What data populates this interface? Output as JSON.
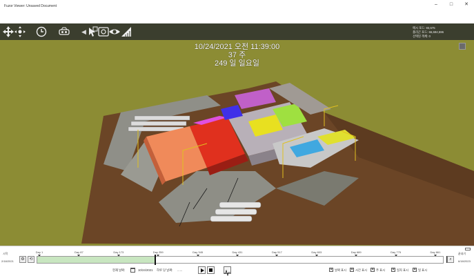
{
  "window": {
    "title": "Fuzor Viewer: Unsaved Document",
    "minimize": "–",
    "maximize": "□",
    "close": "✕"
  },
  "toolbar": {
    "icons": [
      "move-icon",
      "orbit-icon",
      "clock-icon",
      "vr-headset-icon",
      "collapse-arrow-icon",
      "cursor-icon",
      "screenshot-icon",
      "eye-icon",
      "measure-icon"
    ],
    "separator": "◀"
  },
  "stats": [
    {
      "label": "메시 포드",
      "value": "83,675"
    },
    {
      "label": "폴리곤 포드",
      "value": "66,694,596"
    },
    {
      "label": "선택된 객체",
      "value": "0"
    }
  ],
  "overlay": {
    "datetime": "10/24/2021 오전 11:39:00",
    "week": "37 주",
    "day": "249 일 일요일"
  },
  "timeline": {
    "start_label": "시작",
    "end_label": "끝내기",
    "start_date": "2/18/2021",
    "end_date": "6/18/2023",
    "ticks": [
      "Day 1",
      "Day 87",
      "Day 173",
      "Day 259",
      "Day 345",
      "Day 431",
      "Day 517",
      "Day 603",
      "Day 689",
      "Day 775",
      "Day 861"
    ],
    "progress_fraction": 0.29,
    "current_label": "현재 날짜:",
    "current_date": "10/24/2021",
    "speed_label": "하루 당 날짜:",
    "speed_value": "......",
    "checkboxes": [
      {
        "label": "날짜 표시",
        "checked": true
      },
      {
        "label": "시간 표시",
        "checked": true
      },
      {
        "label": "주 표시",
        "checked": true
      },
      {
        "label": "일자 표시",
        "checked": true
      },
      {
        "label": "일 표시",
        "checked": true
      }
    ]
  },
  "colors": {
    "toolbar_bg": "#3b3e2e",
    "ground": "#8c8c34",
    "site": "#6b4526",
    "timeline_fill": "#c8e6c0"
  }
}
